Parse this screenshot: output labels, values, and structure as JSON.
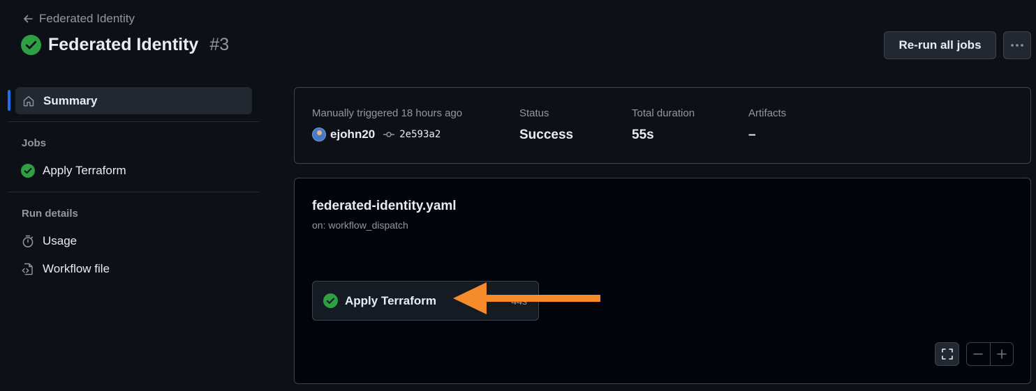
{
  "header": {
    "back_label": "Federated Identity",
    "title": "Federated Identity",
    "run_number": "#3",
    "rerun_label": "Re-run all jobs"
  },
  "sidebar": {
    "summary_label": "Summary",
    "jobs_heading": "Jobs",
    "jobs": [
      {
        "label": "Apply Terraform",
        "status": "success"
      }
    ],
    "run_details_heading": "Run details",
    "run_details": [
      {
        "label": "Usage",
        "icon": "stopwatch-icon"
      },
      {
        "label": "Workflow file",
        "icon": "file-code-icon"
      }
    ]
  },
  "summary": {
    "trigger_label": "Manually triggered 18 hours ago",
    "actor": "ejohn20",
    "commit": "2e593a2",
    "status_label": "Status",
    "status_value": "Success",
    "duration_label": "Total duration",
    "duration_value": "55s",
    "artifacts_label": "Artifacts",
    "artifacts_value": "–"
  },
  "workflow": {
    "file_name": "federated-identity.yaml",
    "trigger": "on: workflow_dispatch",
    "job_label": "Apply Terraform",
    "job_duration": "44s"
  },
  "colors": {
    "success": "#2ea043",
    "accent": "#1f6feb",
    "annotation_arrow": "#f68b2c"
  }
}
